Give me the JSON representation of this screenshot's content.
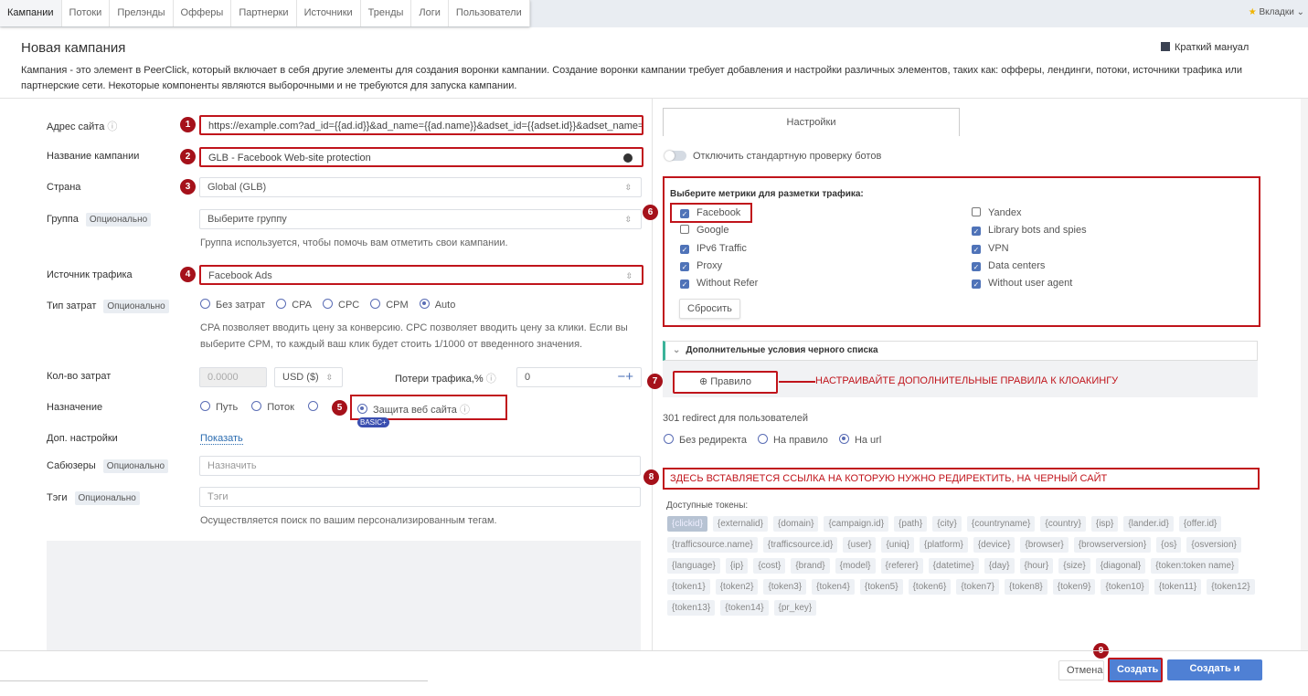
{
  "nav": {
    "tabs": [
      "Кампании",
      "Потоки",
      "Прелэнды",
      "Офферы",
      "Партнерки",
      "Источники",
      "Тренды",
      "Логи",
      "Пользователи"
    ],
    "bookmarks": "Вкладки"
  },
  "header": {
    "title": "Новая кампания",
    "manual": "Краткий мануал",
    "description1": "Кампания - это элемент в PeerClick, который включает в себя другие элементы для создания воронки кампании. Создание воронки кампании требует добавления и настройки различных элементов, таких как: офферы, лендинги, потоки, источники трафика или",
    "description2": "партнерские сети. Некоторые компоненты являются выборочными и не требуются для запуска кампании."
  },
  "form": {
    "optional": "Опционально",
    "site_label": "Адрес сайта",
    "site_value": "https://example.com?ad_id={{ad.id}}&ad_name={{ad.name}}&adset_id={{adset.id}}&adset_name={{ads",
    "name_label": "Название кампании",
    "name_value": "GLB - Facebook Web-site protection",
    "country_label": "Страна",
    "country_value": "Global (GLB)",
    "group_label": "Группа",
    "group_placeholder": "Выберите группу",
    "group_hint": "Группа используется, чтобы помочь вам отметить свои кампании.",
    "source_label": "Источник трафика",
    "source_value": "Facebook Ads",
    "cost_type_label": "Тип затрат",
    "cost_types": [
      "Без затрат",
      "CPA",
      "CPC",
      "CPM",
      "Auto"
    ],
    "cost_hint1": "CPA позволяет вводить цену за конверсию. CPC позволяет вводить цену за клики. Если вы",
    "cost_hint2": "выберите CPM, то каждый ваш клик будет стоить 1/1000 от введенного значения.",
    "cost_amount_label": "Кол-во затрат",
    "cost_amount": "0.0000",
    "currency": "USD ($)",
    "loss_label": "Потери трафика,%",
    "loss_value": "0",
    "dest_label": "Назначение",
    "dest_options": [
      "Путь",
      "Поток",
      "Защита веб сайта"
    ],
    "basic_badge": "BASIC+",
    "extra_label": "Доп. настройки",
    "extra_link": "Показать",
    "subusers_label": "Сабюзеры",
    "subusers_placeholder": "Назначить",
    "tags_label": "Тэги",
    "tags_placeholder": "Тэги",
    "tags_hint": "Осуществляется поиск по вашим персонализированным тегам."
  },
  "right": {
    "tab": "Настройки",
    "toggle_label": "Отключить стандартную проверку ботов",
    "metrics_title": "Выберите метрики для разметки трафика:",
    "metrics_left": [
      {
        "label": "Facebook",
        "checked": true
      },
      {
        "label": "Google",
        "checked": false
      },
      {
        "label": "IPv6 Traffic",
        "checked": true
      },
      {
        "label": "Proxy",
        "checked": true
      },
      {
        "label": "Without Refer",
        "checked": true
      }
    ],
    "metrics_right": [
      {
        "label": "Yandex",
        "checked": false
      },
      {
        "label": "Library bots and spies",
        "checked": true
      },
      {
        "label": "VPN",
        "checked": true
      },
      {
        "label": "Data centers",
        "checked": true
      },
      {
        "label": "Without user agent",
        "checked": true
      }
    ],
    "reset": "Сбросить",
    "blacklist": "Дополнительные условия черного списка",
    "rule_button": "Правило",
    "annotation7": "НАСТРАИВАЙТЕ ДОПОЛНИТЕЛЬНЫЕ ПРАВИЛА К КЛОАКИНГУ",
    "redirect_label": "301 redirect для пользователей",
    "redirect_options": [
      "Без редиректа",
      "На правило",
      "На url"
    ],
    "annotation8": "ЗДЕСЬ ВСТАВЛЯЕТСЯ ССЫЛКА НА КОТОРУЮ НУЖНО РЕДИРЕКТИТЬ, НА ЧЕРНЫЙ САЙТ",
    "tokens_label": "Доступные токены:",
    "tokens": [
      "{clickid}",
      "{externalid}",
      "{domain}",
      "{campaign.id}",
      "{path}",
      "{city}",
      "{countryname}",
      "{country}",
      "{isp}",
      "{lander.id}",
      "{offer.id}",
      "{trafficsource.name}",
      "{trafficsource.id}",
      "{user}",
      "{uniq}",
      "{platform}",
      "{device}",
      "{browser}",
      "{browserversion}",
      "{os}",
      "{osversion}",
      "{language}",
      "{ip}",
      "{cost}",
      "{brand}",
      "{model}",
      "{referer}",
      "{datetime}",
      "{day}",
      "{hour}",
      "{size}",
      "{diagonal}",
      "{token:token name}",
      "{token1}",
      "{token2}",
      "{token3}",
      "{token4}",
      "{token5}",
      "{token6}",
      "{token7}",
      "{token8}",
      "{token9}",
      "{token10}",
      "{token11}",
      "{token12}",
      "{token13}",
      "{token14}",
      "{pr_key}"
    ]
  },
  "footer": {
    "cancel": "Отмена",
    "create": "Создать",
    "create_close": "Создать и закрыть"
  },
  "steps": [
    "1",
    "2",
    "3",
    "4",
    "5",
    "6",
    "7",
    "8",
    "9"
  ]
}
